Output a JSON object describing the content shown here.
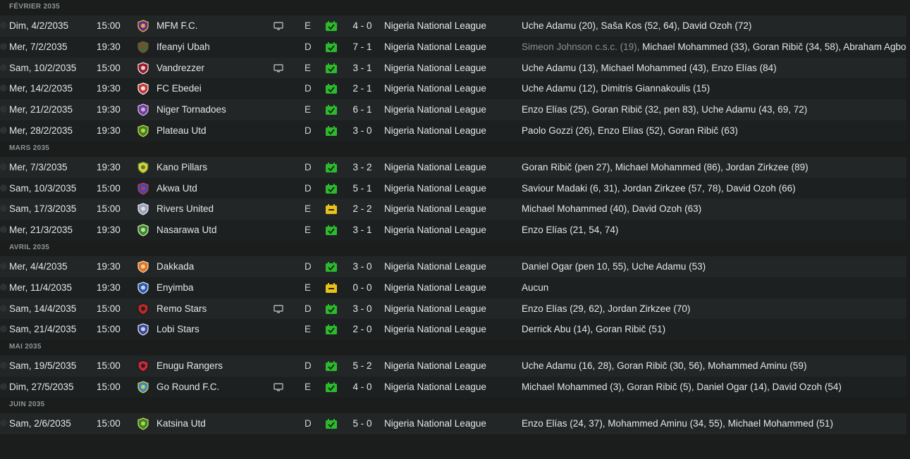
{
  "colors": {
    "win": "#2db82d",
    "draw": "#e8c21c",
    "background": "#1b1d1d"
  },
  "sections": [
    {
      "month": "FÉVRIER 2035",
      "matches": [
        {
          "date": "Dim, 4/2/2035",
          "time": "15:00",
          "team": "MFM F.C.",
          "crest": [
            "#6a2a8a",
            "#e2c44a"
          ],
          "tv": true,
          "venue": "E",
          "result": "win",
          "score": "4 - 0",
          "competition": "Nigeria National League",
          "scorers_muted": "",
          "scorers": "Uche Adamu (20), Saša Kos (52, 64), David Ozoh (72)"
        },
        {
          "date": "Mer, 7/2/2035",
          "time": "19:30",
          "team": "Ifeanyi Ubah",
          "crest": [
            "#1f7a3a",
            "#c62828"
          ],
          "tv": false,
          "venue": "D",
          "result": "win",
          "score": "7 - 1",
          "competition": "Nigeria National League",
          "scorers_muted": "Simeon Johnson c.s.c. (19), ",
          "scorers": "Michael Mohammed (33), Goran Ribič (34, 58), Abraham Agbo"
        },
        {
          "date": "Sam, 10/2/2035",
          "time": "15:00",
          "team": "Vandrezzer",
          "crest": [
            "#9a1c2a",
            "#f0f0f0"
          ],
          "tv": true,
          "venue": "E",
          "result": "win",
          "score": "3 - 1",
          "competition": "Nigeria National League",
          "scorers_muted": "",
          "scorers": "Uche Adamu (13), Michael Mohammed (43), Enzo Elías (84)"
        },
        {
          "date": "Mer, 14/2/2035",
          "time": "19:30",
          "team": "FC Ebedei",
          "crest": [
            "#c23a3a",
            "#ffffff"
          ],
          "tv": false,
          "venue": "D",
          "result": "win",
          "score": "2 - 1",
          "competition": "Nigeria National League",
          "scorers_muted": "",
          "scorers": "Uche Adamu (12), Dimitris Giannakoulis (15)"
        },
        {
          "date": "Mer, 21/2/2035",
          "time": "19:30",
          "team": "Niger Tornadoes",
          "crest": [
            "#7a3a9a",
            "#c8c8e8"
          ],
          "tv": false,
          "venue": "E",
          "result": "win",
          "score": "6 - 1",
          "competition": "Nigeria National League",
          "scorers_muted": "",
          "scorers": "Enzo Elías (25), Goran Ribič (32, pen 83), Uche Adamu (43, 69, 72)"
        },
        {
          "date": "Mer, 28/2/2035",
          "time": "19:30",
          "team": "Plateau Utd",
          "crest": [
            "#2f8a2f",
            "#e8d23a"
          ],
          "tv": false,
          "venue": "D",
          "result": "win",
          "score": "3 - 0",
          "competition": "Nigeria National League",
          "scorers_muted": "",
          "scorers": "Paolo Gozzi (26), Enzo Elías (52), Goran Ribič (63)"
        }
      ]
    },
    {
      "month": "MARS 2035",
      "matches": [
        {
          "date": "Mer, 7/3/2035",
          "time": "19:30",
          "team": "Kano Pillars",
          "crest": [
            "#e8c83a",
            "#2a7a3a"
          ],
          "tv": false,
          "venue": "D",
          "result": "win",
          "score": "3 - 2",
          "competition": "Nigeria National League",
          "scorers_muted": "",
          "scorers": "Goran Ribič (pen 27), Michael Mohammed (86), Jordan Zirkzee (89)"
        },
        {
          "date": "Sam, 10/3/2035",
          "time": "15:00",
          "team": "Akwa Utd",
          "crest": [
            "#3a4ab8",
            "#d03a3a"
          ],
          "tv": false,
          "venue": "D",
          "result": "win",
          "score": "5 - 1",
          "competition": "Nigeria National League",
          "scorers_muted": "",
          "scorers": "Saviour Madaki (6, 31), Jordan Zirkzee (57, 78), David Ozoh (66)"
        },
        {
          "date": "Sam, 17/3/2035",
          "time": "15:00",
          "team": "Rivers United",
          "crest": [
            "#9aa4b8",
            "#e8e8f0"
          ],
          "tv": false,
          "venue": "E",
          "result": "draw",
          "score": "2 - 2",
          "competition": "Nigeria National League",
          "scorers_muted": "",
          "scorers": "Michael Mohammed (40), David Ozoh (63)"
        },
        {
          "date": "Mer, 21/3/2035",
          "time": "19:30",
          "team": "Nasarawa Utd",
          "crest": [
            "#2f8a3a",
            "#e8e8a0"
          ],
          "tv": false,
          "venue": "E",
          "result": "win",
          "score": "3 - 1",
          "competition": "Nigeria National League",
          "scorers_muted": "",
          "scorers": "Enzo Elías (21, 54, 74)"
        }
      ]
    },
    {
      "month": "AVRIL 2035",
      "matches": [
        {
          "date": "Mer, 4/4/2035",
          "time": "19:30",
          "team": "Dakkada",
          "crest": [
            "#e0722a",
            "#f5e0b0"
          ],
          "tv": false,
          "venue": "D",
          "result": "win",
          "score": "3 - 0",
          "competition": "Nigeria National League",
          "scorers_muted": "",
          "scorers": "Daniel Ogar (pen 10, 55), Uche Adamu (53)"
        },
        {
          "date": "Mer, 11/4/2035",
          "time": "19:30",
          "team": "Enyimba",
          "crest": [
            "#2a5ab8",
            "#e8e8e8"
          ],
          "tv": false,
          "venue": "E",
          "result": "draw",
          "score": "0 - 0",
          "competition": "Nigeria National League",
          "scorers_muted": "",
          "scorers": "Aucun"
        },
        {
          "date": "Sam, 14/4/2035",
          "time": "15:00",
          "team": "Remo Stars",
          "crest": [
            "#b82a2a",
            "#1a1a1a"
          ],
          "tv": true,
          "venue": "D",
          "result": "win",
          "score": "3 - 0",
          "competition": "Nigeria National League",
          "scorers_muted": "",
          "scorers": "Enzo Elías (29, 62), Jordan Zirkzee (70)"
        },
        {
          "date": "Sam, 21/4/2035",
          "time": "15:00",
          "team": "Lobi Stars",
          "crest": [
            "#3a4a9a",
            "#e8e8f0"
          ],
          "tv": false,
          "venue": "E",
          "result": "win",
          "score": "2 - 0",
          "competition": "Nigeria National League",
          "scorers_muted": "",
          "scorers": "Derrick Abu (14), Goran Ribič (51)"
        }
      ]
    },
    {
      "month": "MAI 2035",
      "matches": [
        {
          "date": "Sam, 19/5/2035",
          "time": "15:00",
          "team": "Enugu Rangers",
          "crest": [
            "#c82a3a",
            "#1a1a1a"
          ],
          "tv": false,
          "venue": "D",
          "result": "win",
          "score": "5 - 2",
          "competition": "Nigeria National League",
          "scorers_muted": "",
          "scorers": "Uche Adamu (16, 28), Goran Ribič (30, 56), Mohammed Aminu (59)"
        },
        {
          "date": "Dim, 27/5/2035",
          "time": "15:00",
          "team": "Go Round F.C.",
          "crest": [
            "#3a8ac8",
            "#e8d23a"
          ],
          "tv": true,
          "venue": "E",
          "result": "win",
          "score": "4 - 0",
          "competition": "Nigeria National League",
          "scorers_muted": "",
          "scorers": "Michael Mohammed (3), Goran Ribič (5), Daniel Ogar (14), David Ozoh (54)"
        }
      ]
    },
    {
      "month": "JUIN 2035",
      "matches": [
        {
          "date": "Sam, 2/6/2035",
          "time": "15:00",
          "team": "Katsina Utd",
          "crest": [
            "#2a8a3a",
            "#e8d23a"
          ],
          "tv": false,
          "venue": "D",
          "result": "win",
          "score": "5 - 0",
          "competition": "Nigeria National League",
          "scorers_muted": "",
          "scorers": "Enzo Elías (24, 37), Mohammed Aminu (34, 55), Michael Mohammed (51)"
        }
      ]
    }
  ]
}
